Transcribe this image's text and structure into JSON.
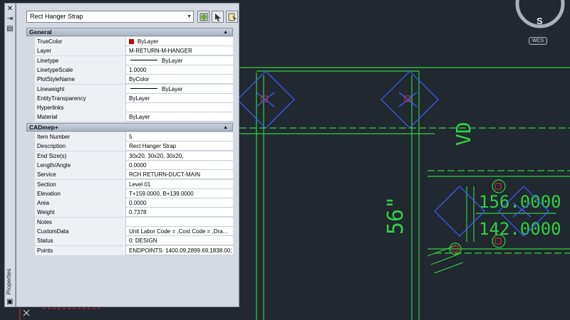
{
  "window": {
    "palette_title": "Properties",
    "selector_value": "Rect Hanger Strap"
  },
  "categories": {
    "general": "General",
    "cadmep": "CADmep+"
  },
  "general_rows": [
    {
      "name": "TrueColor",
      "value": "ByLayer",
      "swatch": "#c40000"
    },
    {
      "name": "Layer",
      "value": "M-RETURN-M-HANGER"
    },
    {
      "name": "Linetype",
      "value": "ByLayer"
    },
    {
      "name": "LinetypeScale",
      "value": "1.0000"
    },
    {
      "name": "PlotStyleName",
      "value": "ByColor"
    },
    {
      "name": "Lineweight",
      "value": "ByLayer"
    },
    {
      "name": "EntityTransparency",
      "value": "ByLayer"
    },
    {
      "name": "Hyperlinks",
      "value": ""
    },
    {
      "name": "Material",
      "value": "ByLayer"
    }
  ],
  "cadmep_rows": [
    {
      "name": "Item Number",
      "value": "5"
    },
    {
      "name": "Description",
      "value": "Rect Hanger Strap"
    },
    {
      "name": "End Size(s)",
      "value": " 30x20,  30x20,  30x20,"
    },
    {
      "name": "Length/Angle",
      "value": "0.0000"
    },
    {
      "name": "Service",
      "value": "RCH RETURN-DUCT-MAIN"
    },
    {
      "name": "Section",
      "value": "Level 01"
    },
    {
      "name": "Elevation",
      "value": "T+159.0000, B+139.0000"
    },
    {
      "name": "Area",
      "value": "0.0000"
    },
    {
      "name": "Weight",
      "value": "0.7378"
    },
    {
      "name": "Notes",
      "value": ""
    },
    {
      "name": "CustomData",
      "value": "Unit Labor Code = ,Cost Code = ,Dra..."
    },
    {
      "name": "Status",
      "value": " 0: DESIGN"
    },
    {
      "name": "Points",
      "value": "ENDPOINTS: 1400.09,2899.69,1838.00;"
    }
  ],
  "drawing": {
    "viewcube_label": "S",
    "ucs_label": "WCS",
    "dim_vertical": "56\"",
    "dim_vd": "VD",
    "elev_top": "156.0000",
    "elev_bottom": "142.0000"
  },
  "colors": {
    "background": "#212830",
    "duct_green": "#30d040",
    "hanger_blue": "#3a5fff",
    "marker_red": "#e03030"
  }
}
